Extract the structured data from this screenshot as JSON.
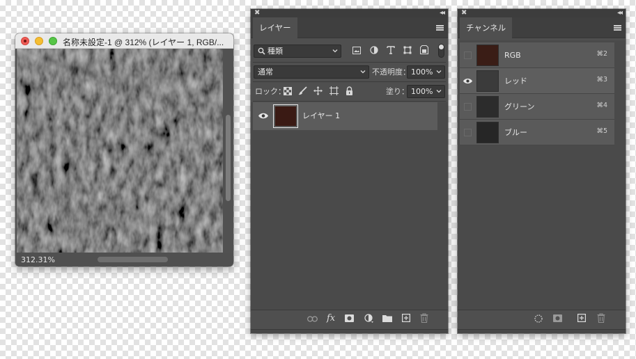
{
  "document_window": {
    "title": "名称未設定-1 @ 312% (レイヤー 1, RGB/...",
    "zoom": "312.31%"
  },
  "layers_panel": {
    "tab_label": "レイヤー",
    "filter": {
      "kind_label": "種類",
      "filter_icons": [
        "image-filter-icon",
        "adjustment-filter-icon",
        "type-filter-icon",
        "shape-filter-icon",
        "smart-object-filter-icon"
      ]
    },
    "blend_mode": "通常",
    "opacity_label": "不透明度：",
    "opacity_value": "100%",
    "lock_label": "ロック：",
    "fill_label": "塗り：",
    "fill_value": "100%",
    "layers": [
      {
        "name": "レイヤー 1",
        "visible": true,
        "thumb_color": "#3a1a14"
      }
    ],
    "footer_icons": [
      "link-icon",
      "fx-icon",
      "mask-icon",
      "adjustment-icon",
      "folder-icon",
      "new-layer-icon",
      "trash-icon"
    ],
    "footer_fx_text": "fx"
  },
  "channels_panel": {
    "tab_label": "チャンネル",
    "channels": [
      {
        "name": "RGB",
        "shortcut": "⌘2",
        "visible": false,
        "thumb_color": "#3a1d16"
      },
      {
        "name": "レッド",
        "shortcut": "⌘3",
        "visible": true,
        "thumb_color": "#3b3b3b"
      },
      {
        "name": "グリーン",
        "shortcut": "⌘4",
        "visible": false,
        "thumb_color": "#2c2c2c"
      },
      {
        "name": "ブルー",
        "shortcut": "⌘5",
        "visible": false,
        "thumb_color": "#262626"
      }
    ],
    "footer_icons": [
      "load-selection-icon",
      "save-selection-icon",
      "new-channel-icon",
      "trash-icon"
    ]
  },
  "colors": {
    "panel_bg": "#4f4f4f",
    "tab_bar_bg": "#3f3f3f",
    "selected_layer_bg": "#5c5c5c",
    "accent_text": "#e6e6e6"
  }
}
